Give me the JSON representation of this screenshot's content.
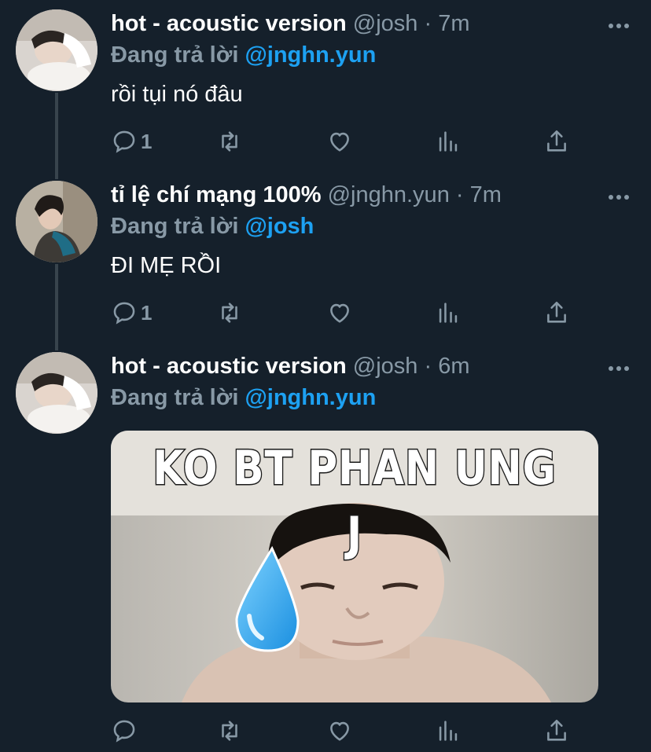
{
  "tweets": [
    {
      "name": "hot - acoustic version",
      "handle": "@josh",
      "dot": "·",
      "time": "7m",
      "reply_prefix": "Đang trả lời",
      "reply_to": "@jnghn.yun",
      "text": "rồi tụi nó đâu",
      "reply_count": "1"
    },
    {
      "name": "tỉ lệ chí mạng 100%",
      "handle": "@jnghn.yun",
      "dot": "·",
      "time": "7m",
      "reply_prefix": "Đang trả lời",
      "reply_to": "@josh",
      "text": "ĐI MẸ RỒI",
      "reply_count": "1"
    },
    {
      "name": "hot - acoustic version",
      "handle": "@josh",
      "dot": "·",
      "time": "6m",
      "reply_prefix": "Đang trả lời",
      "reply_to": "@jnghn.yun",
      "media_caption": "KO BT PHAN UNG J",
      "reply_count": ""
    }
  ],
  "icons": {
    "reply": "reply-icon",
    "retweet": "retweet-icon",
    "like": "heart-icon",
    "analytics": "analytics-icon",
    "share": "share-icon",
    "more": "more-icon"
  },
  "colors": {
    "background": "#15202b",
    "muted": "#8899a6",
    "accent": "#1da1f2",
    "thread_line": "#38444d"
  }
}
